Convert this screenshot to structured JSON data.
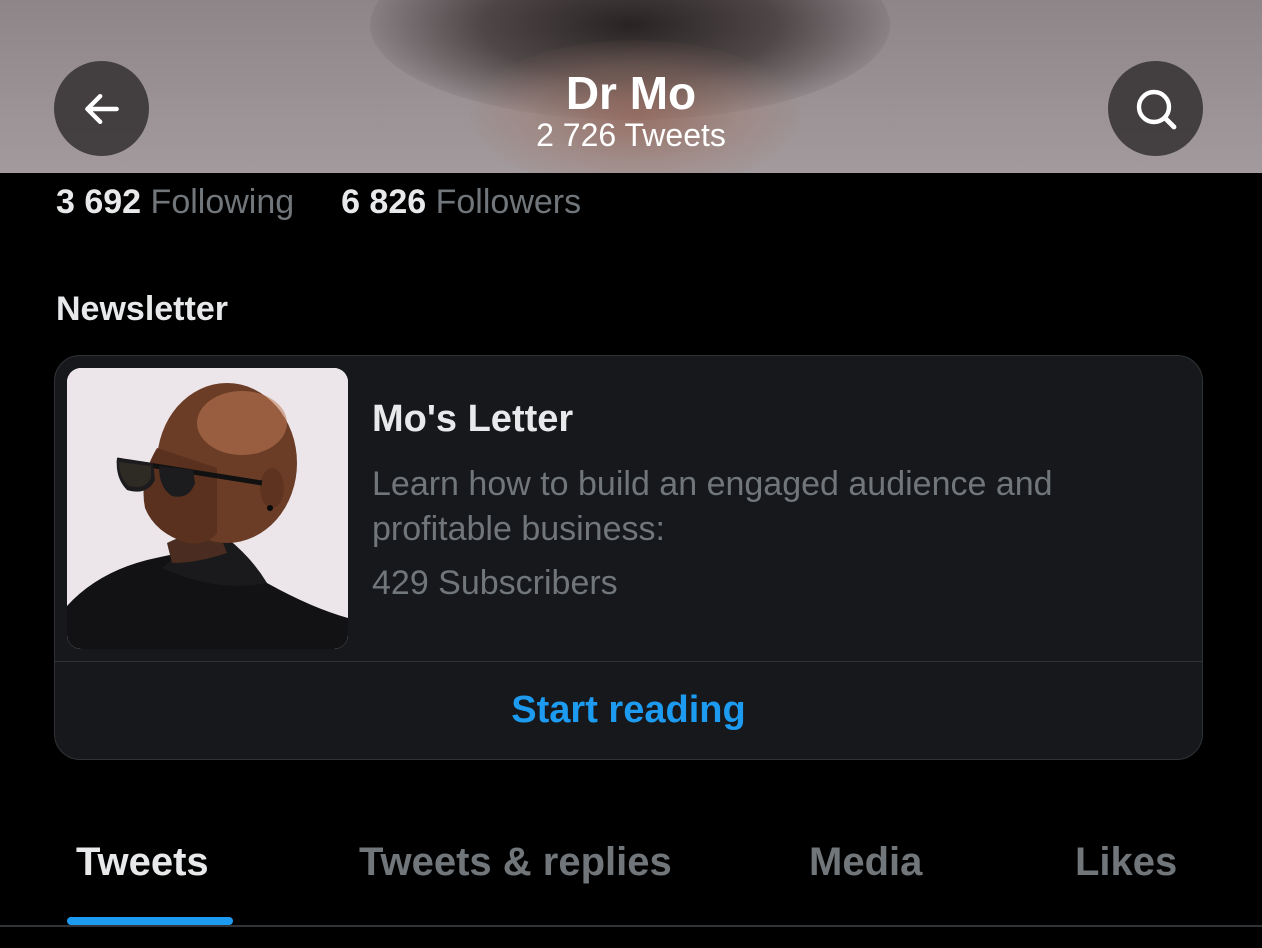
{
  "header": {
    "title": "Dr Mo",
    "subtitle": "2 726 Tweets",
    "back_icon": "arrow-left-icon",
    "search_icon": "search-icon"
  },
  "stats": {
    "following_count": "3 692",
    "following_label": "Following",
    "followers_count": "6 826",
    "followers_label": "Followers"
  },
  "newsletter": {
    "section_title": "Newsletter",
    "name": "Mo's Letter",
    "description": "Learn how to build an engaged audience and profitable business:",
    "subscribers": "429 Subscribers",
    "cta": "Start reading"
  },
  "tabs": [
    {
      "label": "Tweets",
      "active": true
    },
    {
      "label": "Tweets & replies",
      "active": false
    },
    {
      "label": "Media",
      "active": false
    },
    {
      "label": "Likes",
      "active": false
    }
  ],
  "colors": {
    "accent": "#1d9bf0",
    "background": "#000000",
    "card": "#16181c",
    "muted_text": "#71767b",
    "primary_text": "#e7e9ea"
  }
}
